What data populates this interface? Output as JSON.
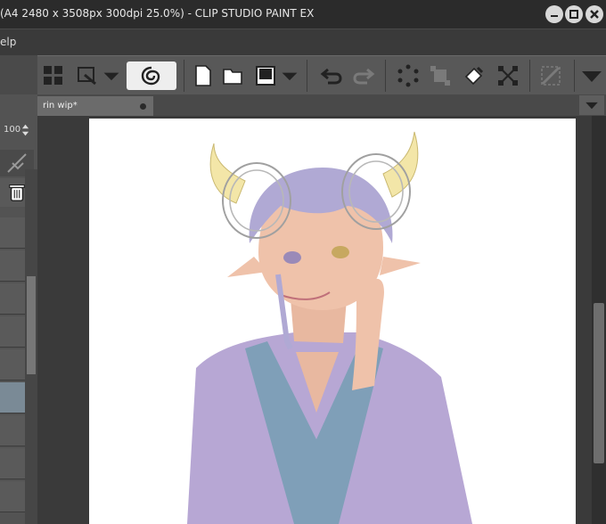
{
  "window": {
    "title": "(A4 2480 x 3508px 300dpi 25.0%)  - CLIP STUDIO PAINT EX"
  },
  "menu": {
    "help_label": "elp"
  },
  "tab": {
    "name": "rin wip*"
  },
  "layer_panel": {
    "opacity_value": "100"
  },
  "colors": {
    "titlebar": "#2b2b2b",
    "toolbar": "#585858",
    "accent": "#7a8a96"
  }
}
